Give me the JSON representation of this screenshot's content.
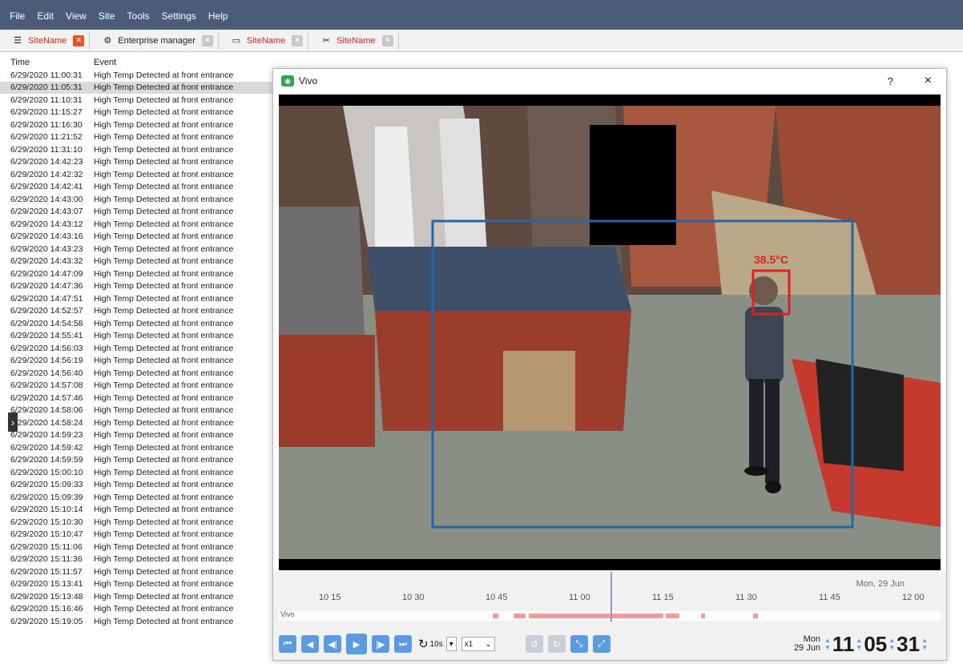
{
  "menu": [
    "File",
    "Edit",
    "View",
    "Site",
    "Tools",
    "Settings",
    "Help"
  ],
  "tabs": [
    {
      "label": "SiteName",
      "icon": "server-icon",
      "active": true
    },
    {
      "label": "Enterprise manager",
      "icon": "enterprise-icon",
      "active": false
    },
    {
      "label": "SiteName",
      "icon": "monitor-icon",
      "active": false
    },
    {
      "label": "SiteName",
      "icon": "tools-icon",
      "active": false
    }
  ],
  "event_list": {
    "col_time": "Time",
    "col_event": "Event",
    "event_text": "High Temp Detected at front entrance",
    "times": [
      "6/29/2020 11:00:31",
      "6/29/2020 11:05:31",
      "6/29/2020 11:10:31",
      "6/29/2020 11:15:27",
      "6/29/2020 11:16:30",
      "6/29/2020 11:21:52",
      "6/29/2020 11:31:10",
      "6/29/2020 14:42:23",
      "6/29/2020 14:42:32",
      "6/29/2020 14:42:41",
      "6/29/2020 14:43:00",
      "6/29/2020 14:43:07",
      "6/29/2020 14:43:12",
      "6/29/2020 14:43:16",
      "6/29/2020 14:43:23",
      "6/29/2020 14:43:32",
      "6/29/2020 14:47:09",
      "6/29/2020 14:47:36",
      "6/29/2020 14:47:51",
      "6/29/2020 14:52:57",
      "6/29/2020 14:54:58",
      "6/29/2020 14:55:41",
      "6/29/2020 14:56:03",
      "6/29/2020 14:56:19",
      "6/29/2020 14:56:40",
      "6/29/2020 14:57:08",
      "6/29/2020 14:57:46",
      "6/29/2020 14:58:06",
      "6/29/2020 14:58:24",
      "6/29/2020 14:59:23",
      "6/29/2020 14:59:42",
      "6/29/2020 14:59:59",
      "6/29/2020 15:00:10",
      "6/29/2020 15:09:33",
      "6/29/2020 15:09:39",
      "6/29/2020 15:10:14",
      "6/29/2020 15:10:30",
      "6/29/2020 15:10:47",
      "6/29/2020 15:11:06",
      "6/29/2020 15:11:36",
      "6/29/2020 15:11:57",
      "6/29/2020 15:13:41",
      "6/29/2020 15:13:48",
      "6/29/2020 15:16:46",
      "6/29/2020 15:19:05"
    ],
    "selected_index": 1
  },
  "vivo": {
    "title": "Vivo",
    "help_label": "?",
    "close_label": "×",
    "temperature": "38.5°C",
    "timeline": {
      "date": "Mon, 29 Jun",
      "ticks": [
        "10 15",
        "10 30",
        "10 45",
        "11 00",
        "11 15",
        "11 30",
        "11 45",
        "12 00"
      ],
      "track_label": "Vivo"
    },
    "controls": {
      "loop_label": "10s",
      "speed_label": "x1"
    },
    "clock": {
      "day": "Mon",
      "date": "29 Jun",
      "hour": "11",
      "minute": "05",
      "second": "31"
    }
  },
  "colors": {
    "menubar": "#4a5c78",
    "accent": "#5b9be0",
    "alert": "#d32424",
    "detection_box": "#2266aa"
  }
}
